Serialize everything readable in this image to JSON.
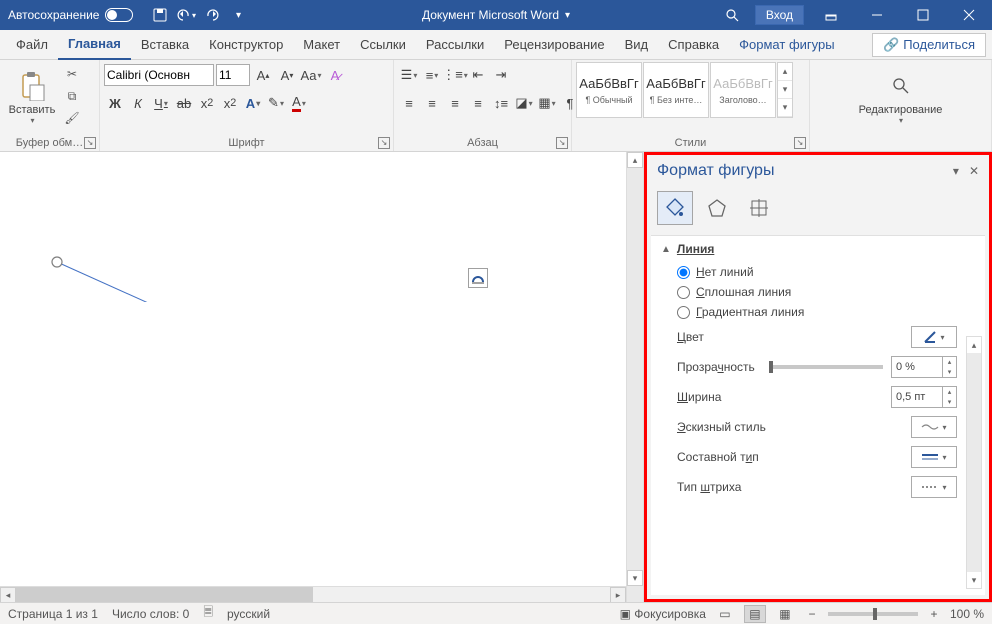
{
  "titlebar": {
    "autosave": "Автосохранение",
    "doc_title": "Документ Microsoft Word",
    "signin": "Вход"
  },
  "tabs": {
    "file": "Файл",
    "home": "Главная",
    "insert": "Вставка",
    "design": "Конструктор",
    "layout": "Макет",
    "references": "Ссылки",
    "mailings": "Рассылки",
    "review": "Рецензирование",
    "view": "Вид",
    "help": "Справка",
    "shape_format": "Формат фигуры",
    "share": "Поделиться"
  },
  "ribbon": {
    "clipboard": {
      "paste": "Вставить",
      "label": "Буфер обм…"
    },
    "font": {
      "name": "Calibri (Основн",
      "size": "11",
      "label": "Шрифт"
    },
    "paragraph": {
      "label": "Абзац"
    },
    "styles": {
      "preview": "АаБбВвГг",
      "normal": "¶ Обычный",
      "nospacing": "¶ Без инте…",
      "heading1": "Заголово…",
      "label": "Стили"
    },
    "editing": {
      "label": "Редактирование"
    }
  },
  "format_pane": {
    "title": "Формат фигуры",
    "section_line": "Линия",
    "no_line": "Нет линий",
    "solid_line": "Сплошная линия",
    "gradient_line": "Градиентная линия",
    "color": "Цвет",
    "transparency": "Прозрачность",
    "transparency_val": "0 %",
    "width": "Ширина",
    "width_val": "0,5 пт",
    "sketch": "Эскизный стиль",
    "compound": "Составной тип",
    "dash": "Тип штриха"
  },
  "status": {
    "page": "Страница 1 из 1",
    "words": "Число слов: 0",
    "lang": "русский",
    "focus": "Фокусировка",
    "zoom": "100 %"
  }
}
